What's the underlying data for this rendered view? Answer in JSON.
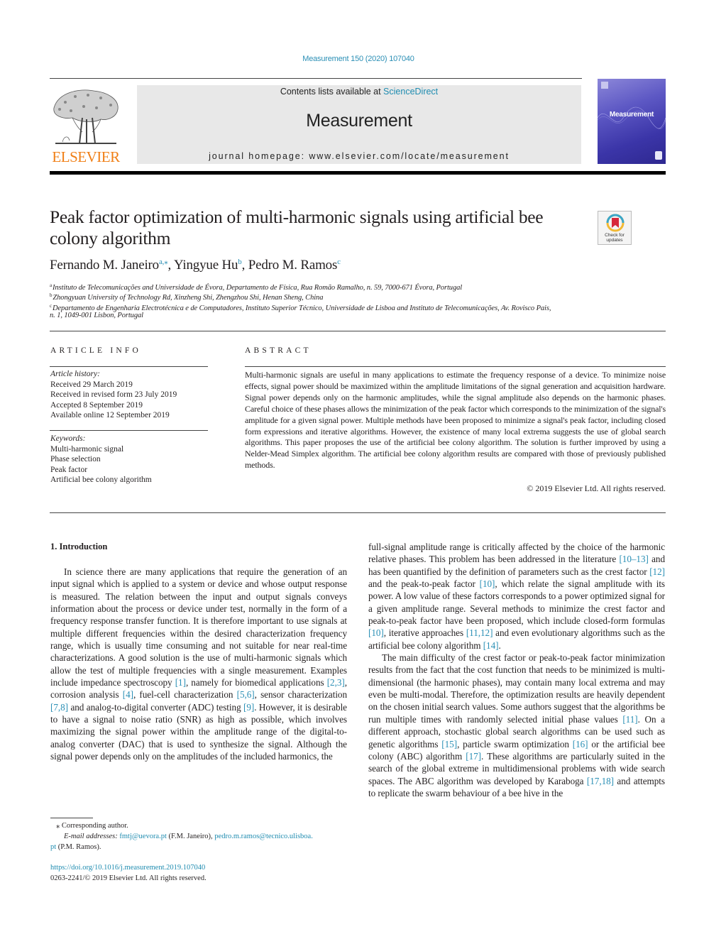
{
  "header": {
    "journal_ref": "Measurement 150 (2020) 107040",
    "publisher_logo_text": "ELSEVIER",
    "contents_prefix": "Contents lists available at ",
    "contents_link": "ScienceDirect",
    "journal_name": "Measurement",
    "homepage": "journal homepage: www.elsevier.com/locate/measurement",
    "cover_title": "Measurement"
  },
  "article": {
    "title": "Peak factor optimization of multi-harmonic signals using artificial bee colony algorithm",
    "check_updates_label": "Check for updates",
    "authors": [
      {
        "name": "Fernando M. Janeiro",
        "sup": "a,⁎"
      },
      {
        "name": "Yingyue Hu",
        "sup": "b"
      },
      {
        "name": "Pedro M. Ramos",
        "sup": "c"
      }
    ],
    "affiliations": [
      {
        "mark": "a",
        "text": "Instituto de Telecomunicações and Universidade de Évora, Departamento de Física, Rua Romão Ramalho, n. 59, 7000-671 Évora, Portugal"
      },
      {
        "mark": "b",
        "text": "Zhongyuan University of Technology Rd, Xinzheng Shi, Zhengzhou Shi, Henan Sheng, China"
      },
      {
        "mark": "c",
        "text": "Departamento de Engenharia Electrotécnica e de Computadores, Instituto Superior Técnico, Universidade de Lisboa and Instituto de Telecomunicações, Av. Rovisco Pais,",
        "cont": "n. 1, 1049-001 Lisbon, Portugal"
      }
    ]
  },
  "article_info": {
    "heading": "ARTICLE INFO",
    "history_label": "Article history:",
    "history": [
      "Received 29 March 2019",
      "Received in revised form 23 July 2019",
      "Accepted 8 September 2019",
      "Available online 12 September 2019"
    ],
    "keywords_label": "Keywords:",
    "keywords": [
      "Multi-harmonic signal",
      "Phase selection",
      "Peak factor",
      "Artificial bee colony algorithm"
    ]
  },
  "abstract": {
    "heading": "ABSTRACT",
    "text": "Multi-harmonic signals are useful in many applications to estimate the frequency response of a device. To minimize noise effects, signal power should be maximized within the amplitude limitations of the signal generation and acquisition hardware. Signal power depends only on the harmonic amplitudes, while the signal amplitude also depends on the harmonic phases. Careful choice of these phases allows the minimization of the peak factor which corresponds to the minimization of the signal's amplitude for a given signal power. Multiple methods have been proposed to minimize a signal's peak factor, including closed form expressions and iterative algorithms. However, the existence of many local extrema suggests the use of global search algorithms. This paper proposes the use of the artificial bee colony algorithm. The solution is further improved by using a Nelder-Mead Simplex algorithm. The artificial bee colony algorithm results are compared with those of previously published methods.",
    "copyright": "© 2019 Elsevier Ltd. All rights reserved."
  },
  "body": {
    "section_heading": "1. Introduction",
    "left": {
      "p1": [
        {
          "t": "In science there are many applications that require the generation of an input signal which is applied to a system or device and whose output response is measured. The relation between the input and output signals conveys information about the process or device under test, normally in the form of a frequency response transfer function. It is therefore important to use signals at multiple different frequencies within the desired characterization frequency range, which is usually time consuming and not suitable for near real-time characterizations. A good solution is the use of multi-harmonic signals which allow the test of multiple frequencies with a single measurement. Examples include impedance spectroscopy "
        },
        {
          "c": "[1]"
        },
        {
          "t": ", namely for biomedical applications "
        },
        {
          "c": "[2,3]"
        },
        {
          "t": ", corrosion analysis "
        },
        {
          "c": "[4]"
        },
        {
          "t": ", fuel-cell characterization "
        },
        {
          "c": "[5,6]"
        },
        {
          "t": ", sensor characterization "
        },
        {
          "c": "[7,8]"
        },
        {
          "t": " and analog-to-digital converter (ADC) testing "
        },
        {
          "c": "[9]"
        },
        {
          "t": ". However, it is desirable to have a signal to noise ratio (SNR) as high as possible, which involves maximizing the signal power within the amplitude range of the digital-to-analog converter (DAC) that is used to synthesize the signal. Although the signal power depends only on the amplitudes of the included harmonics, the"
        }
      ]
    },
    "right": {
      "p1": [
        {
          "t": "full-signal amplitude range is critically affected by the choice of the harmonic relative phases. This problem has been addressed in the literature "
        },
        {
          "c": "[10–13]"
        },
        {
          "t": " and has been quantified by the definition of parameters such as the crest factor "
        },
        {
          "c": "[12]"
        },
        {
          "t": " and the peak-to-peak factor "
        },
        {
          "c": "[10]"
        },
        {
          "t": ", which relate the signal amplitude with its power. A low value of these factors corresponds to a power optimized signal for a given amplitude range. Several methods to minimize the crest factor and peak-to-peak factor have been proposed, which include closed-form formulas "
        },
        {
          "c": "[10]"
        },
        {
          "t": ", iterative approaches "
        },
        {
          "c": "[11,12]"
        },
        {
          "t": " and even evolutionary algorithms such as the artificial bee colony algorithm "
        },
        {
          "c": "[14]"
        },
        {
          "t": "."
        }
      ],
      "p2": [
        {
          "t": "The main difficulty of the crest factor or peak-to-peak factor minimization results from the fact that the cost function that needs to be minimized is multi-dimensional (the harmonic phases), may contain many local extrema and may even be multi-modal. Therefore, the optimization results are heavily dependent on the chosen initial search values. Some authors suggest that the algorithms be run multiple times with randomly selected initial phase values "
        },
        {
          "c": "[11]"
        },
        {
          "t": ". On a different approach, stochastic global search algorithms can be used such as genetic algorithms "
        },
        {
          "c": "[15]"
        },
        {
          "t": ", particle swarm optimization "
        },
        {
          "c": "[16]"
        },
        {
          "t": " or the artificial bee colony (ABC) algorithm "
        },
        {
          "c": "[17]"
        },
        {
          "t": ". These algorithms are particularly suited in the search of the global extreme in multidimensional problems with wide search spaces. The ABC algorithm was developed by Karaboga "
        },
        {
          "c": "[17,18]"
        },
        {
          "t": " and attempts to replicate the swarm behaviour of a bee hive in the"
        }
      ]
    }
  },
  "footnotes": {
    "corresponding": "Corresponding author.",
    "corresponding_mark": "⁎",
    "email_label": "E-mail addresses:",
    "email1": "fmtj@uevora.pt",
    "email1_owner": " (F.M. Janeiro), ",
    "email2_a": "pedro.m.ramos@tecnico.ulisboa.",
    "email2_b": "pt",
    "email2_owner": " (P.M. Ramos).",
    "doi": "https://doi.org/10.1016/j.measurement.2019.107040",
    "issn_copyright": "0263-2241/© 2019 Elsevier Ltd. All rights reserved."
  }
}
